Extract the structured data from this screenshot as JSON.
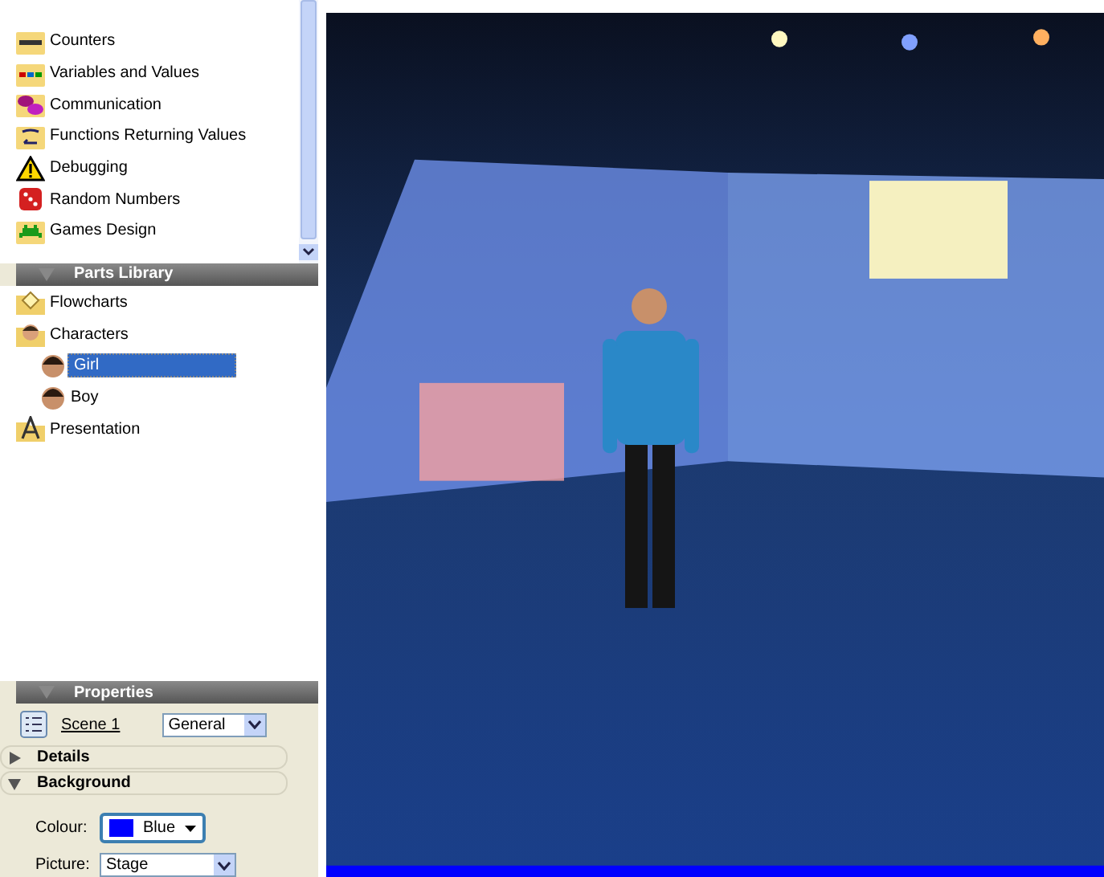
{
  "categories": [
    {
      "label": "Counters",
      "kind": "counter"
    },
    {
      "label": "Variables and Values",
      "kind": "variable"
    },
    {
      "label": "Communication",
      "kind": "speech"
    },
    {
      "label": "Functions Returning Values",
      "kind": "function"
    },
    {
      "label": "Debugging",
      "kind": "warning"
    },
    {
      "label": "Random Numbers",
      "kind": "dice"
    },
    {
      "label": "Games Design",
      "kind": "invader"
    }
  ],
  "parts_library": {
    "title": "Parts Library",
    "items": [
      {
        "label": "Flowcharts",
        "kind": "folder",
        "selected": false
      },
      {
        "label": "Characters",
        "kind": "folder-face",
        "selected": false,
        "children": [
          {
            "label": "Girl",
            "kind": "face",
            "selected": true
          },
          {
            "label": "Boy",
            "kind": "face",
            "selected": false
          }
        ]
      },
      {
        "label": "Presentation",
        "kind": "folder-letter",
        "selected": false
      }
    ]
  },
  "properties": {
    "title": "Properties",
    "object": "Scene 1",
    "view": "General",
    "sections": [
      {
        "label": "Details",
        "expanded": false
      },
      {
        "label": "Background",
        "expanded": true
      }
    ],
    "colour": {
      "label": "Colour:",
      "value": "Blue",
      "color": "#0000ff"
    },
    "picture": {
      "label": "Picture:",
      "value": "Stage"
    }
  }
}
